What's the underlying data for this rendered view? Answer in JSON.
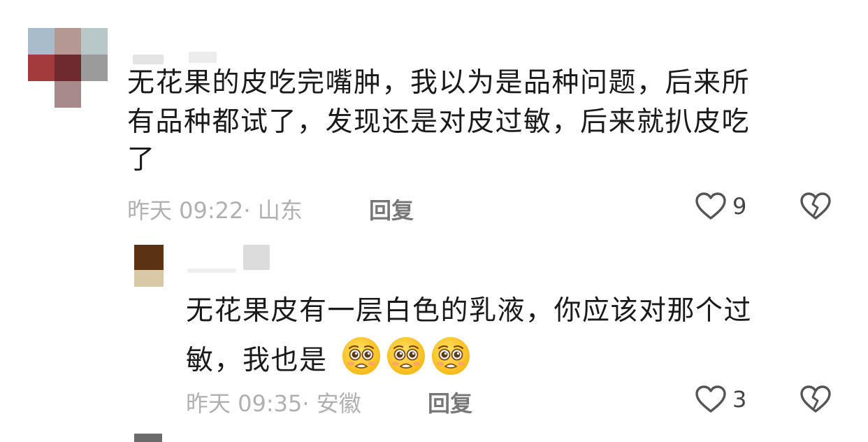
{
  "comments": [
    {
      "text_line1": "无花果的皮吃完嘴肿，我以为是品种问题，后来所",
      "text_line2": "有品种都试了，发现还是对皮过敏，后来就扒皮吃",
      "text_line3": "了",
      "time": "昨天 09:22",
      "location": "· 山东",
      "reply_label": "回复",
      "likes": "9",
      "like_icon": "heart-outline-icon",
      "dislike_icon": "broken-heart-icon"
    },
    {
      "text_line1": "无花果皮有一层白色的乳液，你应该对那个过",
      "text_line2": "敏，我也是",
      "emoji_count": 3,
      "emoji_icon": "pleading-face-emoji",
      "time": "昨天 09:35",
      "location": "· 安徽",
      "reply_label": "回复",
      "likes": "3",
      "like_icon": "heart-outline-icon",
      "dislike_icon": "broken-heart-icon"
    }
  ],
  "colors": {
    "text": "#1a1a1a",
    "meta": "#b0b0b0",
    "reply": "#777777",
    "icon": "#555555",
    "avatar1_mosaic": [
      "#a9bcc9",
      "#b59892",
      "#b8c7c7",
      "#a33a3b",
      "#6e2a2f",
      "#9b9b9b",
      "#ffffff",
      "#a98a8a",
      "#ffffff"
    ],
    "avatar2_mosaic": [
      "#5a3214",
      "#d9c8a6"
    ]
  }
}
